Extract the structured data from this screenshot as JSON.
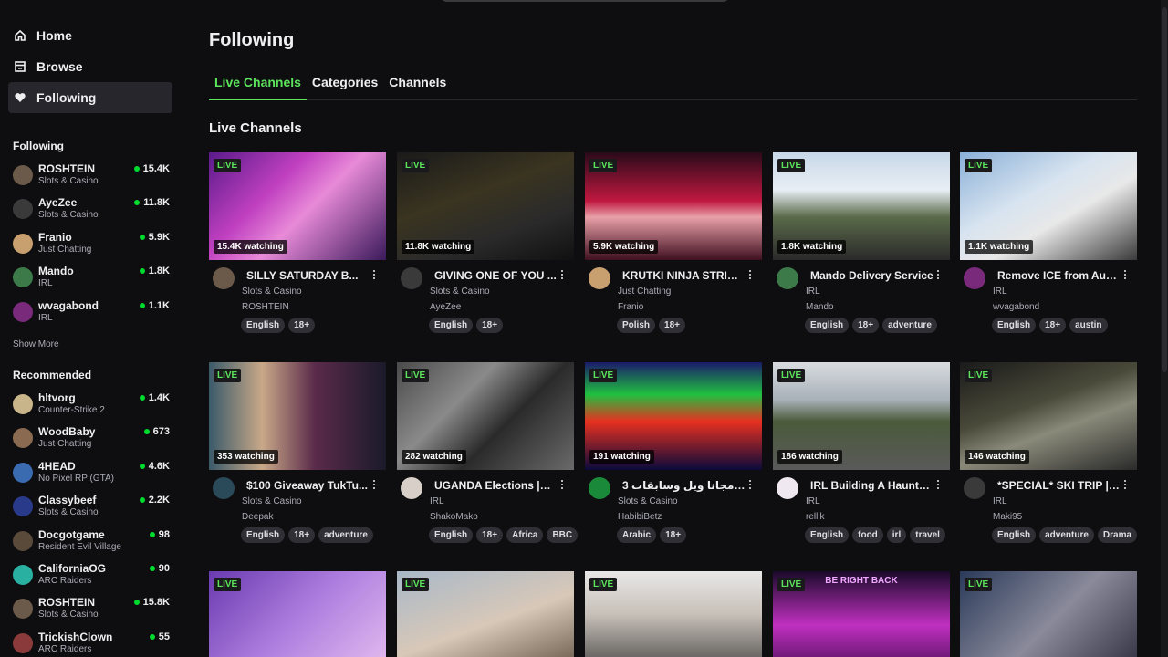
{
  "nav": [
    {
      "label": "Home",
      "icon": "home-icon"
    },
    {
      "label": "Browse",
      "icon": "browse-icon"
    },
    {
      "label": "Following",
      "icon": "heart-icon"
    }
  ],
  "sidebar": {
    "following_title": "Following",
    "following": [
      {
        "name": "ROSHTEIN",
        "game": "Slots & Casino",
        "viewers": "15.4K",
        "color": "#6b5a4a"
      },
      {
        "name": "AyeZee",
        "game": "Slots & Casino",
        "viewers": "11.8K",
        "color": "#3a3a3a"
      },
      {
        "name": "Franio",
        "game": "Just Chatting",
        "viewers": "5.9K",
        "color": "#c8a070"
      },
      {
        "name": "Mando",
        "game": "IRL",
        "viewers": "1.8K",
        "color": "#3d7a4a"
      },
      {
        "name": "wvagabond",
        "game": "IRL",
        "viewers": "1.1K",
        "color": "#7a2a7a"
      }
    ],
    "show_more": "Show More",
    "recommended_title": "Recommended",
    "recommended": [
      {
        "name": "hltvorg",
        "game": "Counter-Strike 2",
        "viewers": "1.4K",
        "color": "#c9b58a"
      },
      {
        "name": "WoodBaby",
        "game": "Just Chatting",
        "viewers": "673",
        "color": "#8a6a50"
      },
      {
        "name": "4HEAD",
        "game": "No Pixel RP (GTA)",
        "viewers": "4.6K",
        "color": "#3a6ab0"
      },
      {
        "name": "Classybeef",
        "game": "Slots & Casino",
        "viewers": "2.2K",
        "color": "#2a3a8a"
      },
      {
        "name": "Docgotgame",
        "game": "Resident Evil Village",
        "viewers": "98",
        "color": "#5a4a3a"
      },
      {
        "name": "CaliforniaOG",
        "game": "ARC Raiders",
        "viewers": "90",
        "color": "#2ab0a0"
      },
      {
        "name": "ROSHTEIN",
        "game": "Slots & Casino",
        "viewers": "15.8K",
        "color": "#6b5a4a"
      },
      {
        "name": "TrickishClown",
        "game": "ARC Raiders",
        "viewers": "55",
        "color": "#8a3a3a"
      }
    ]
  },
  "main": {
    "page_title": "Following",
    "tabs": [
      "Live Channels",
      "Categories",
      "Channels"
    ],
    "section_title": "Live Channels",
    "live_label": "LIVE"
  },
  "streams": [
    {
      "viewers": "15.4K watching",
      "title": "SILLY SATURDAY B...",
      "category": "Slots & Casino",
      "user": "ROSHTEIN",
      "tags": [
        "English",
        "18+"
      ],
      "thumb": "linear-gradient(135deg,#5a1a8a 0%,#c040c0 35%,#e88ad8 55%,#3a1a5a 100%)",
      "avatar": "#6b5a4a"
    },
    {
      "viewers": "11.8K watching",
      "title": "GIVING ONE OF YOU ...",
      "category": "Slots & Casino",
      "user": "AyeZee",
      "tags": [
        "English",
        "18+"
      ],
      "thumb": "linear-gradient(160deg,#1a1a1a 0%,#3a3420 40%,#2a2a2a 70%,#101010 100%)",
      "avatar": "#3a3a3a"
    },
    {
      "viewers": "5.9K watching",
      "title": "KRUTKI NINJA STRIM ...",
      "category": "Just Chatting",
      "user": "Franio",
      "tags": [
        "Polish",
        "18+"
      ],
      "thumb": "linear-gradient(180deg,#2a0a1a 0%,#c01840 45%,#e8a0a8 60%,#401020 100%)",
      "avatar": "#c8a070"
    },
    {
      "viewers": "1.8K watching",
      "title": "Mando Delivery Service",
      "category": "IRL",
      "user": "Mando",
      "tags": [
        "English",
        "18+",
        "adventure"
      ],
      "thumb": "linear-gradient(180deg,#c8d8e8 0%,#e8eef4 35%,#5a6a4a 60%,#2a2a2a 100%)",
      "avatar": "#3d7a4a"
    },
    {
      "viewers": "1.1K watching",
      "title": "Remove ICE from Austin",
      "category": "IRL",
      "user": "wvagabond",
      "tags": [
        "English",
        "18+",
        "austin"
      ],
      "thumb": "linear-gradient(150deg,#8ab0d8 0%,#d8e4f0 40%,#e8e8e8 60%,#3a3a3a 100%)",
      "avatar": "#7a2a7a"
    },
    {
      "viewers": "353 watching",
      "title": "$100 Giveaway TukTu...",
      "category": "Slots & Casino",
      "user": "Deepak",
      "tags": [
        "English",
        "18+",
        "adventure"
      ],
      "thumb": "linear-gradient(90deg,#3a5a6a 0%,#c8a888 30%,#5a2a4a 60%,#1a1a2a 100%)",
      "avatar": "#2a4a5a"
    },
    {
      "viewers": "282 watching",
      "title": "UGANDA Elections |m...",
      "category": "IRL",
      "user": "ShakoMako",
      "tags": [
        "English",
        "18+",
        "Africa",
        "BBC"
      ],
      "thumb": "linear-gradient(135deg,#4a4a4a 0%,#8a8a8a 35%,#2a2a2a 60%,#6a6a6a 100%)",
      "avatar": "#d8d0c8"
    },
    {
      "viewers": "191 watching",
      "title": "3 دولار مجانا ويل وسابقات...",
      "category": "Slots & Casino",
      "user": "HabibiBetz",
      "tags": [
        "Arabic",
        "18+"
      ],
      "thumb": "linear-gradient(180deg,#1a1a6a 0%,#20c040 30%,#e83020 55%,#0a0a3a 100%)",
      "avatar": "#1a8a3a"
    },
    {
      "viewers": "186 watching",
      "title": "IRL Building A Haunte...",
      "category": "IRL",
      "user": "rellik",
      "tags": [
        "English",
        "food",
        "irl",
        "travel"
      ],
      "thumb": "linear-gradient(180deg,#d8dce0 0%,#a8b0b8 35%,#4a5a3a 55%,#5a5a5a 100%)",
      "avatar": "#f0e8f0"
    },
    {
      "viewers": "146 watching",
      "title": "*SPECIAL* SKI TRIP | ...",
      "category": "IRL",
      "user": "Maki95",
      "tags": [
        "English",
        "adventure",
        "Drama"
      ],
      "thumb": "linear-gradient(160deg,#1a1a1a 0%,#4a4a3a 40%,#8a8a7a 60%,#2a2a2a 100%)",
      "avatar": "#3a3a3a"
    },
    {
      "thumb": "linear-gradient(135deg,#6a3ab0 0%,#b080e0 50%,#e8c0f0 100%)"
    },
    {
      "thumb": "linear-gradient(160deg,#a8b8c8 0%,#d8c8b8 50%,#5a4a3a 100%)"
    },
    {
      "thumb": "linear-gradient(180deg,#e8e8e8 0%,#c8c0b8 40%,#3a3a3a 100%)"
    },
    {
      "thumb": "linear-gradient(180deg,#1a0a2a 0%,#c030c0 50%,#3a0a4a 100%)",
      "banner": "BE RIGHT BACK"
    },
    {
      "thumb": "linear-gradient(135deg,#2a3a5a 0%,#8a8a9a 50%,#2a2a3a 100%)"
    }
  ]
}
